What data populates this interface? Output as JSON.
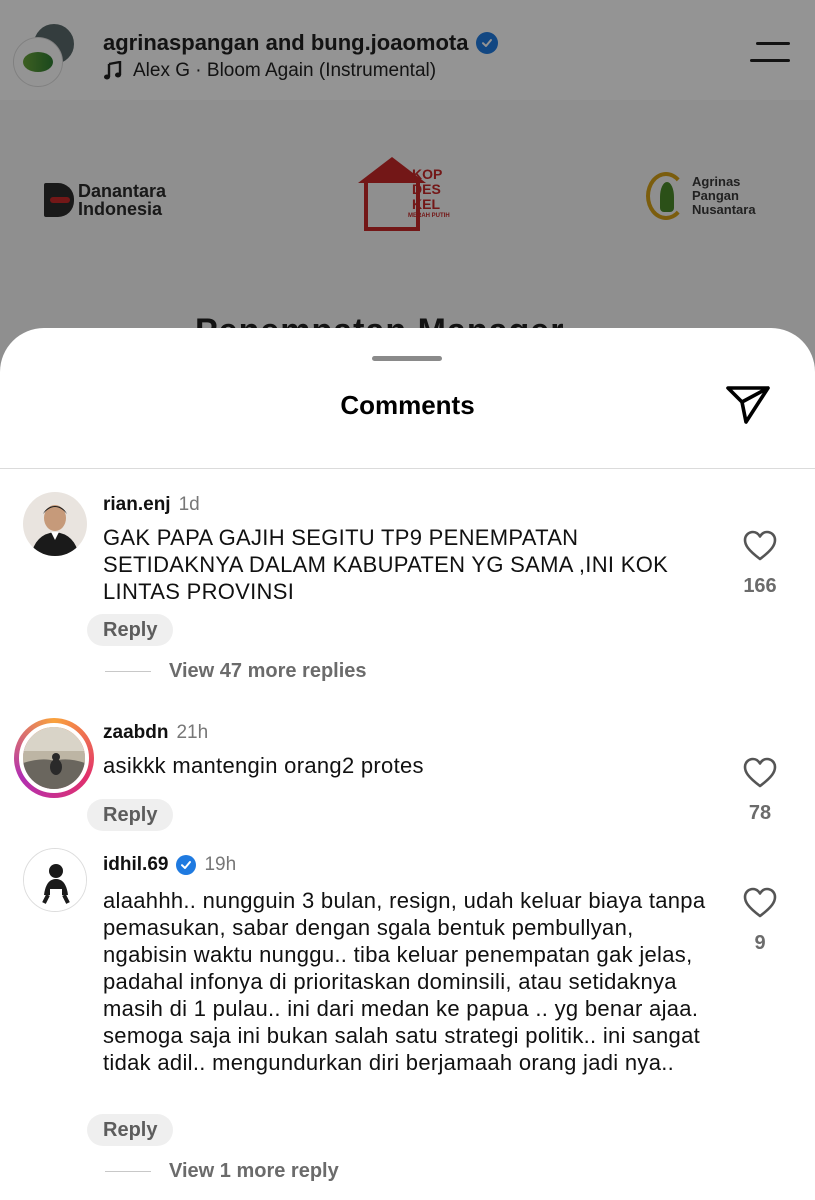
{
  "post": {
    "users": "agrinaspangan and bung.joaomota",
    "music": "Alex G · Bloom Again (Instrumental)",
    "logos": {
      "danantara_line1": "Danantara",
      "danantara_line2": "Indonesia",
      "kop_line1": "KOP",
      "kop_line2": "DES",
      "kop_line3": "KEL",
      "kop_sub": "MERAH PUTIH",
      "agrinas_line1": "Agrinas",
      "agrinas_line2": "Pangan",
      "agrinas_line3": "Nusantara"
    },
    "headline": "Penempatan Manager"
  },
  "comments_sheet": {
    "title": "Comments",
    "comments": [
      {
        "username": "rian.enj",
        "time": "1d",
        "verified": false,
        "text": "GAK PAPA GAJIH SEGITU TP9 PENEMPATAN SETIDAKNYA DALAM KABUPATEN YG SAMA ,INI KOK LINTAS PROVINSI",
        "reply_label": "Reply",
        "likes": "166",
        "view_replies": "View 47 more replies"
      },
      {
        "username": "zaabdn",
        "time": "21h",
        "verified": false,
        "text": "asikkk mantengin orang2 protes",
        "reply_label": "Reply",
        "likes": "78"
      },
      {
        "username": "idhil.69",
        "time": "19h",
        "verified": true,
        "text": "alaahhh.. nungguin 3 bulan, resign, udah keluar biaya tanpa pemasukan, sabar dengan sgala bentuk pembullyan, ngabisin waktu nunggu.. tiba keluar penempatan gak jelas, padahal infonya di prioritaskan dominsili, atau setidaknya masih di 1 pulau.. ini dari medan ke papua .. yg benar ajaa. semoga saja ini bukan salah satu strategi politik.. ini sangat tidak adil.. mengundurkan diri berjamaah orang jadi nya..",
        "reply_label": "Reply",
        "likes": "9",
        "view_replies": "View 1 more reply"
      }
    ]
  },
  "colors": {
    "verified": "#1f7ae0",
    "brand_red": "#c62828",
    "story_ring": "#e1306c"
  }
}
